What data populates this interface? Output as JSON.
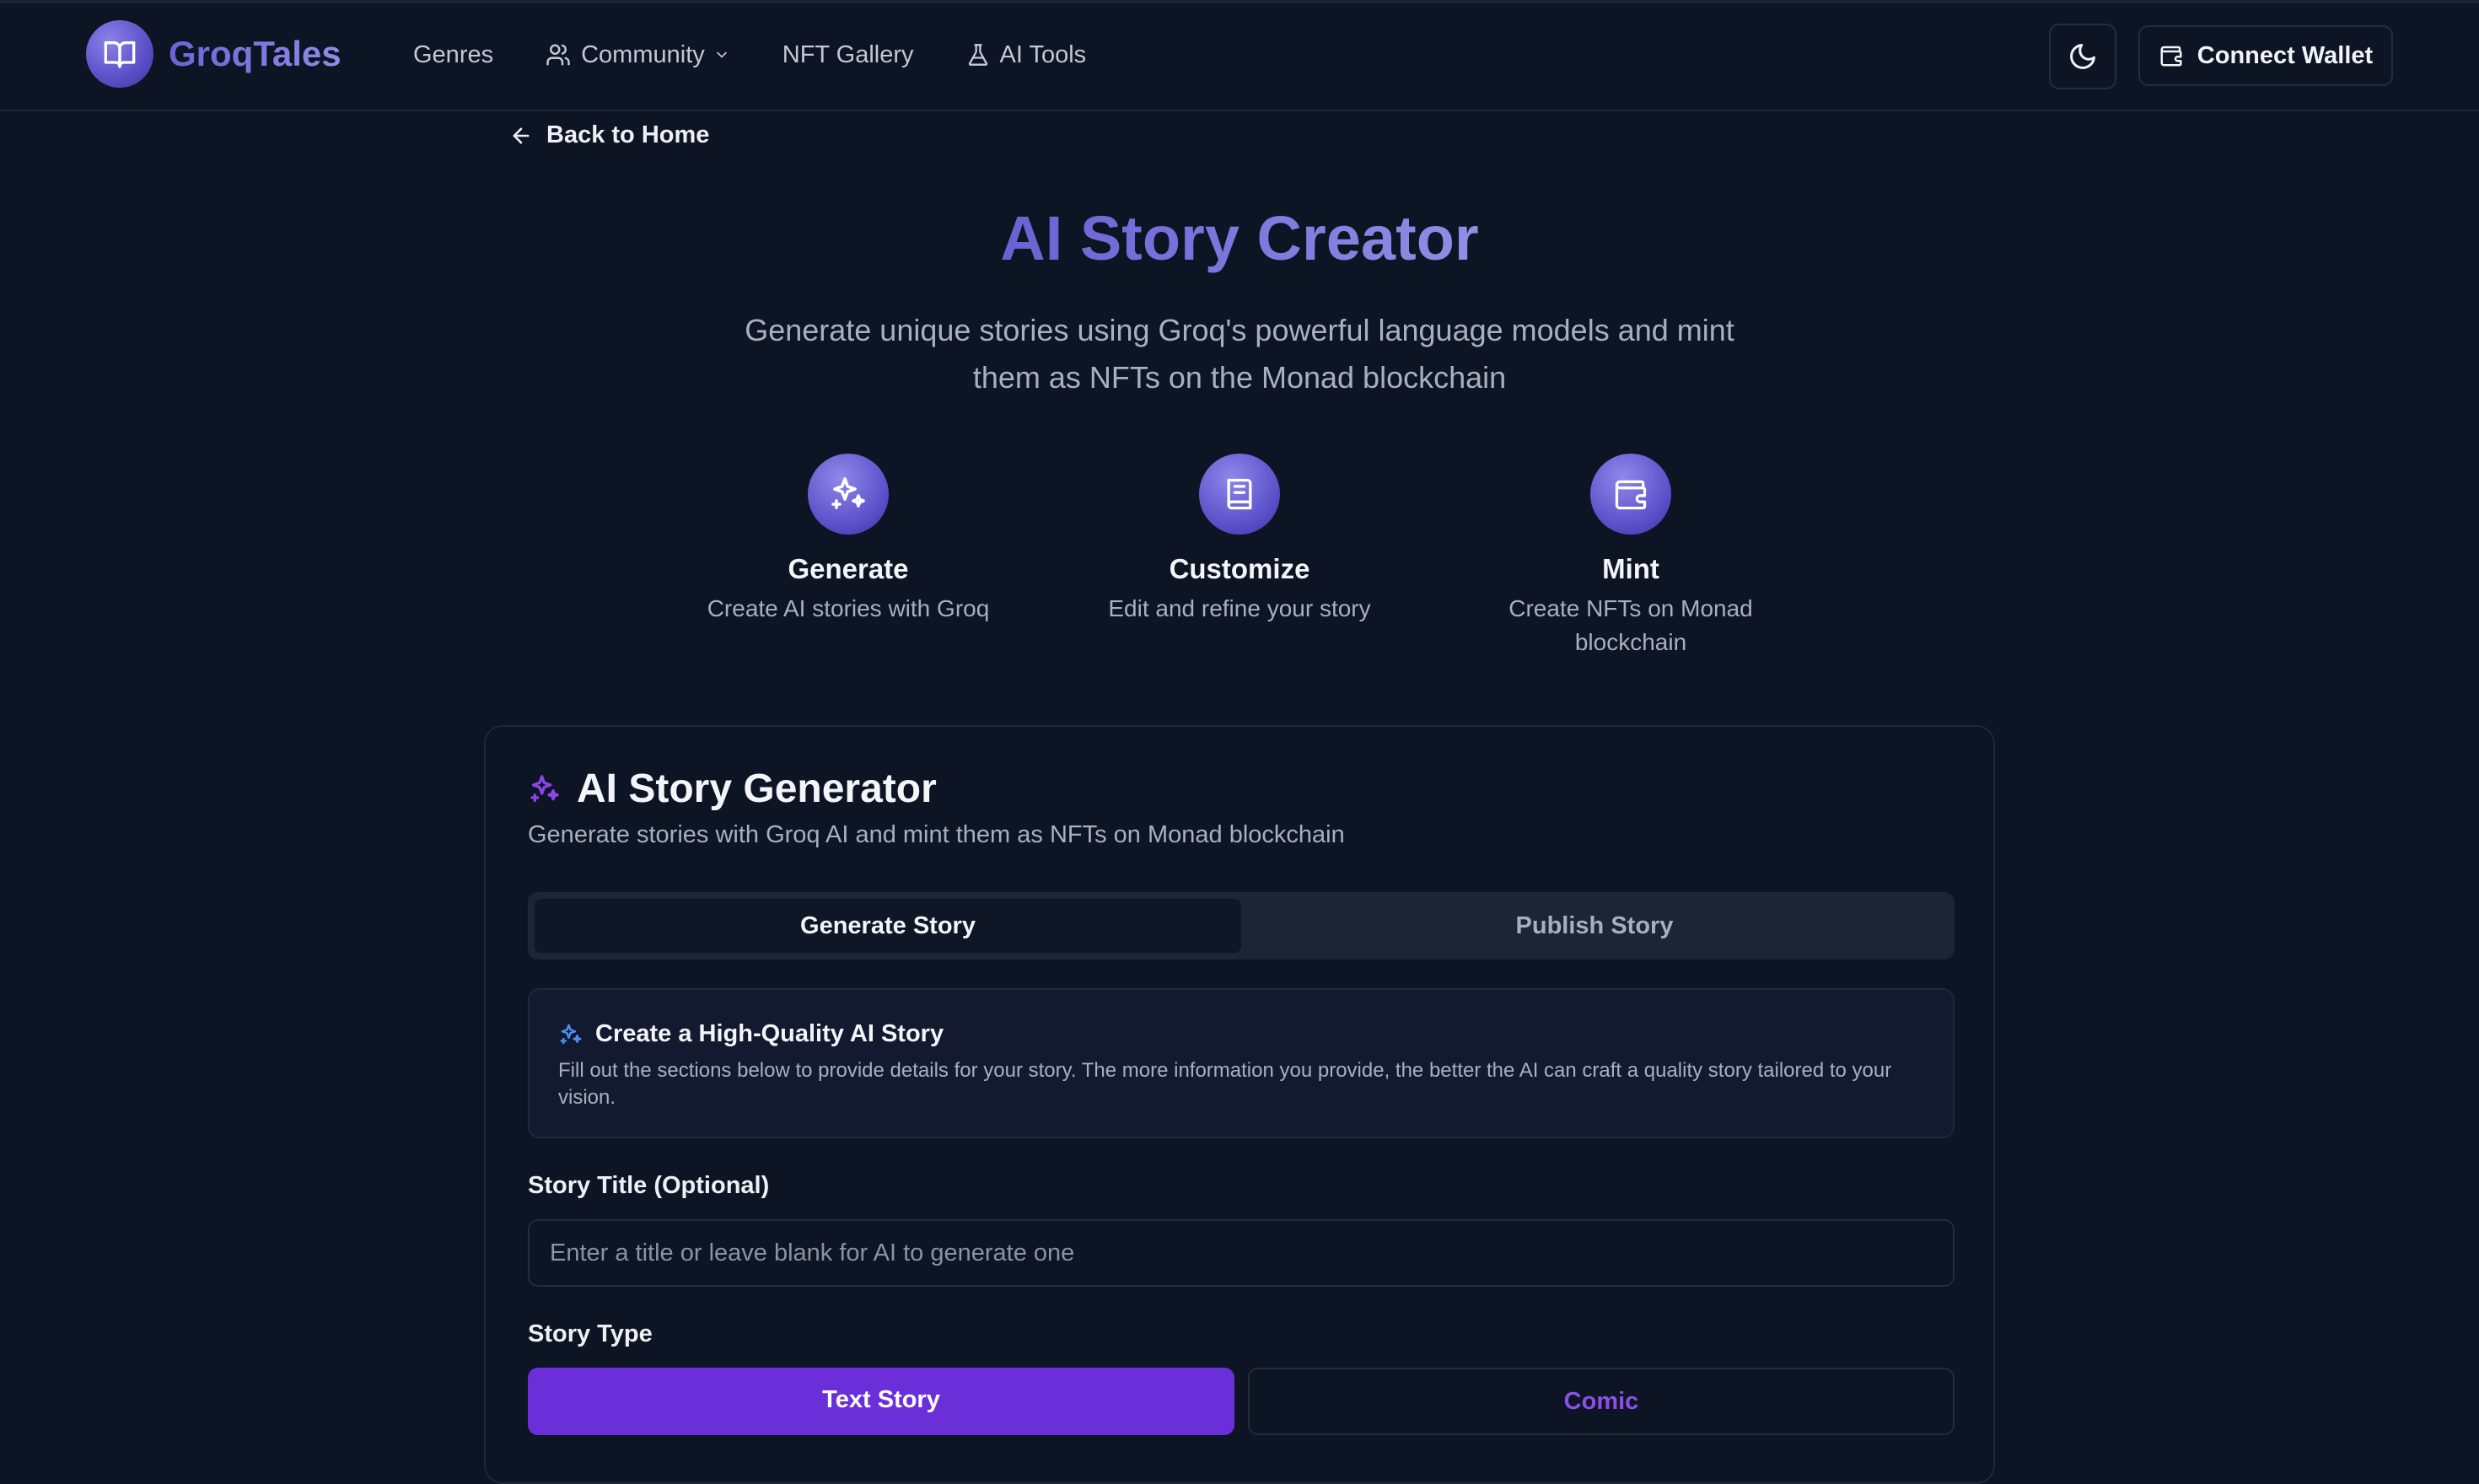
{
  "header": {
    "brand": "GroqTales",
    "nav": [
      {
        "label": "Genres",
        "icon": "none"
      },
      {
        "label": "Community",
        "icon": "users-icon",
        "dropdown": true
      },
      {
        "label": "NFT Gallery",
        "icon": "none"
      },
      {
        "label": "AI Tools",
        "icon": "flask-icon"
      }
    ],
    "theme_toggle_icon": "moon-icon",
    "connect_wallet": "Connect Wallet"
  },
  "back_link": "Back to Home",
  "hero": {
    "title": "AI Story Creator",
    "subtitle_line1": "Generate unique stories using Groq's powerful language models and mint",
    "subtitle_line2": "them as NFTs on the Monad blockchain"
  },
  "features": [
    {
      "title": "Generate",
      "desc": "Create AI stories with Groq",
      "icon": "sparkles-icon"
    },
    {
      "title": "Customize",
      "desc": "Edit and refine your story",
      "icon": "book-icon"
    },
    {
      "title": "Mint",
      "desc_line1": "Create NFTs on Monad",
      "desc_line2": "blockchain",
      "icon": "wallet-icon"
    }
  ],
  "generator": {
    "title": "AI Story Generator",
    "description": "Generate stories with Groq AI and mint them as NFTs on Monad blockchain",
    "tabs": [
      {
        "label": "Generate Story",
        "active": true
      },
      {
        "label": "Publish Story",
        "active": false
      }
    ],
    "info": {
      "title": "Create a High-Quality AI Story",
      "text": "Fill out the sections below to provide details for your story. The more information you provide, the better the AI can craft a quality story tailored to your vision."
    },
    "story_title_label": "Story Title (Optional)",
    "story_title_placeholder": "Enter a title or leave blank for AI to generate one",
    "story_type_label": "Story Type",
    "story_types": [
      {
        "label": "Text Story",
        "active": true
      },
      {
        "label": "Comic",
        "active": false
      }
    ]
  },
  "colors": {
    "background": "#0d1424",
    "accent_purple": "#6a2fd8",
    "brand_gradient_start": "#6a61d2",
    "brand_gradient_end": "#8e8fe6"
  }
}
